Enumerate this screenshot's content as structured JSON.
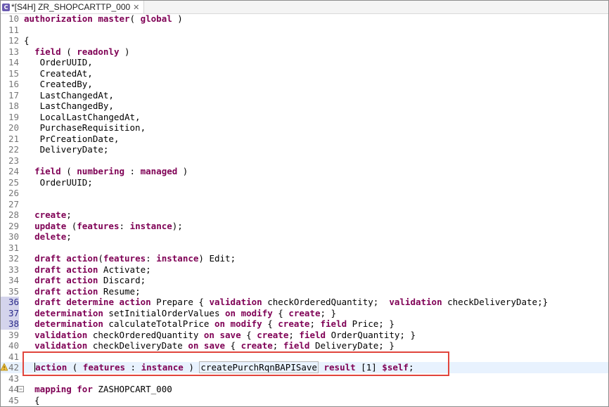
{
  "tab": {
    "title": "*[S4H] ZR_SHOPCARTTP_000",
    "file_icon": "abap-file-icon",
    "close_glyph": "✕"
  },
  "lines": [
    {
      "n": "10",
      "t": "authorization master( global )"
    },
    {
      "n": "11",
      "t": ""
    },
    {
      "n": "12",
      "t": "{"
    },
    {
      "n": "13",
      "t": "  field ( readonly )"
    },
    {
      "n": "14",
      "t": "   OrderUUID,"
    },
    {
      "n": "15",
      "t": "   CreatedAt,"
    },
    {
      "n": "16",
      "t": "   CreatedBy,"
    },
    {
      "n": "17",
      "t": "   LastChangedAt,"
    },
    {
      "n": "18",
      "t": "   LastChangedBy,"
    },
    {
      "n": "19",
      "t": "   LocalLastChangedAt,"
    },
    {
      "n": "20",
      "t": "   PurchaseRequisition,"
    },
    {
      "n": "21",
      "t": "   PrCreationDate,"
    },
    {
      "n": "22",
      "t": "   DeliveryDate;"
    },
    {
      "n": "23",
      "t": ""
    },
    {
      "n": "24",
      "t": "  field ( numbering : managed )"
    },
    {
      "n": "25",
      "t": "   OrderUUID;"
    },
    {
      "n": "26",
      "t": ""
    },
    {
      "n": "27",
      "t": ""
    },
    {
      "n": "28",
      "t": "  create;"
    },
    {
      "n": "29",
      "t": "  update (features: instance);"
    },
    {
      "n": "30",
      "t": "  delete;"
    },
    {
      "n": "31",
      "t": ""
    },
    {
      "n": "32",
      "t": "  draft action(features: instance) Edit;"
    },
    {
      "n": "33",
      "t": "  draft action Activate;"
    },
    {
      "n": "34",
      "t": "  draft action Discard;"
    },
    {
      "n": "35",
      "t": "  draft action Resume;"
    },
    {
      "n": "36",
      "t": "  draft determine action Prepare { validation checkOrderedQuantity;  validation checkDeliveryDate;}"
    },
    {
      "n": "37",
      "t": "  determination setInitialOrderValues on modify { create; }"
    },
    {
      "n": "38",
      "t": "  determination calculateTotalPrice on modify { create; field Price; }"
    },
    {
      "n": "39",
      "t": "  validation checkOrderedQuantity on save { create; field OrderQuantity; }"
    },
    {
      "n": "40",
      "t": "  validation checkDeliveryDate on save { create; field DeliveryDate; }"
    },
    {
      "n": "41",
      "t": ""
    },
    {
      "n": "42",
      "t": "  action ( features : instance ) createPurchRqnBAPISave result [1] $self;"
    },
    {
      "n": "43",
      "t": ""
    },
    {
      "n": "44",
      "t": "  mapping for ZASHOPCART_000"
    },
    {
      "n": "45",
      "t": "  {"
    }
  ],
  "current_line": "42",
  "highlighted_gutter": [
    "36",
    "37",
    "38"
  ],
  "warning_line": "42",
  "fold_line": "44",
  "colors": {
    "keyword": "#7f0055",
    "callout": "#e1453c",
    "current_line_bg": "#e8f2fe"
  }
}
